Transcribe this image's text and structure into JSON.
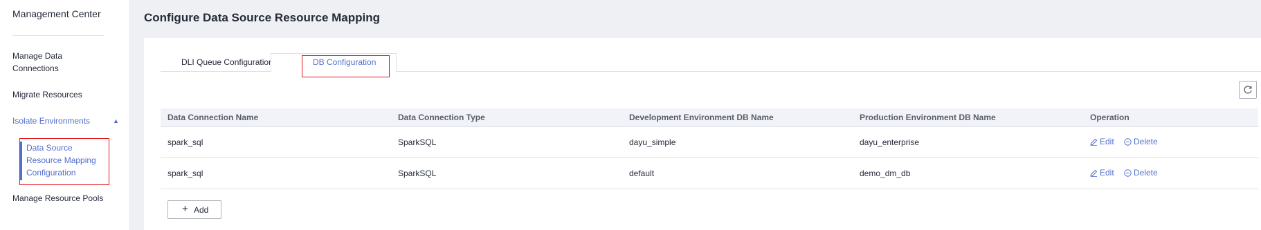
{
  "sidebar": {
    "title": "Management Center",
    "items": [
      {
        "label": "Manage Data Connections"
      },
      {
        "label": "Migrate Resources"
      },
      {
        "label": "Isolate Environments"
      },
      {
        "label": "Data Source Resource Mapping Configuration"
      },
      {
        "label": "Manage Resource Pools"
      }
    ],
    "expanded_icon": "caret-up-icon"
  },
  "page": {
    "title": "Configure Data Source Resource Mapping"
  },
  "tabs": [
    {
      "label": "DLI Queue Configuration",
      "active": false
    },
    {
      "label": "DB Configuration",
      "active": true
    }
  ],
  "toolbar": {
    "refresh_icon": "refresh-icon"
  },
  "table": {
    "headers": [
      "Data Connection Name",
      "Data Connection Type",
      "Development Environment DB Name",
      "Production Environment DB Name",
      "Operation"
    ],
    "rows": [
      {
        "name": "spark_sql",
        "type": "SparkSQL",
        "dev_db": "dayu_simple",
        "prod_db": "dayu_enterprise",
        "edit": "Edit",
        "delete": "Delete"
      },
      {
        "name": "spark_sql",
        "type": "SparkSQL",
        "dev_db": "default",
        "prod_db": "demo_dm_db",
        "edit": "Edit",
        "delete": "Delete"
      }
    ]
  },
  "add_button": {
    "label": "Add",
    "icon": "plus-icon"
  },
  "colors": {
    "accent": "#526ecc",
    "highlight_box": "#e0141d",
    "header_bg": "#f1f3f8",
    "page_bg": "#eff0f3"
  }
}
